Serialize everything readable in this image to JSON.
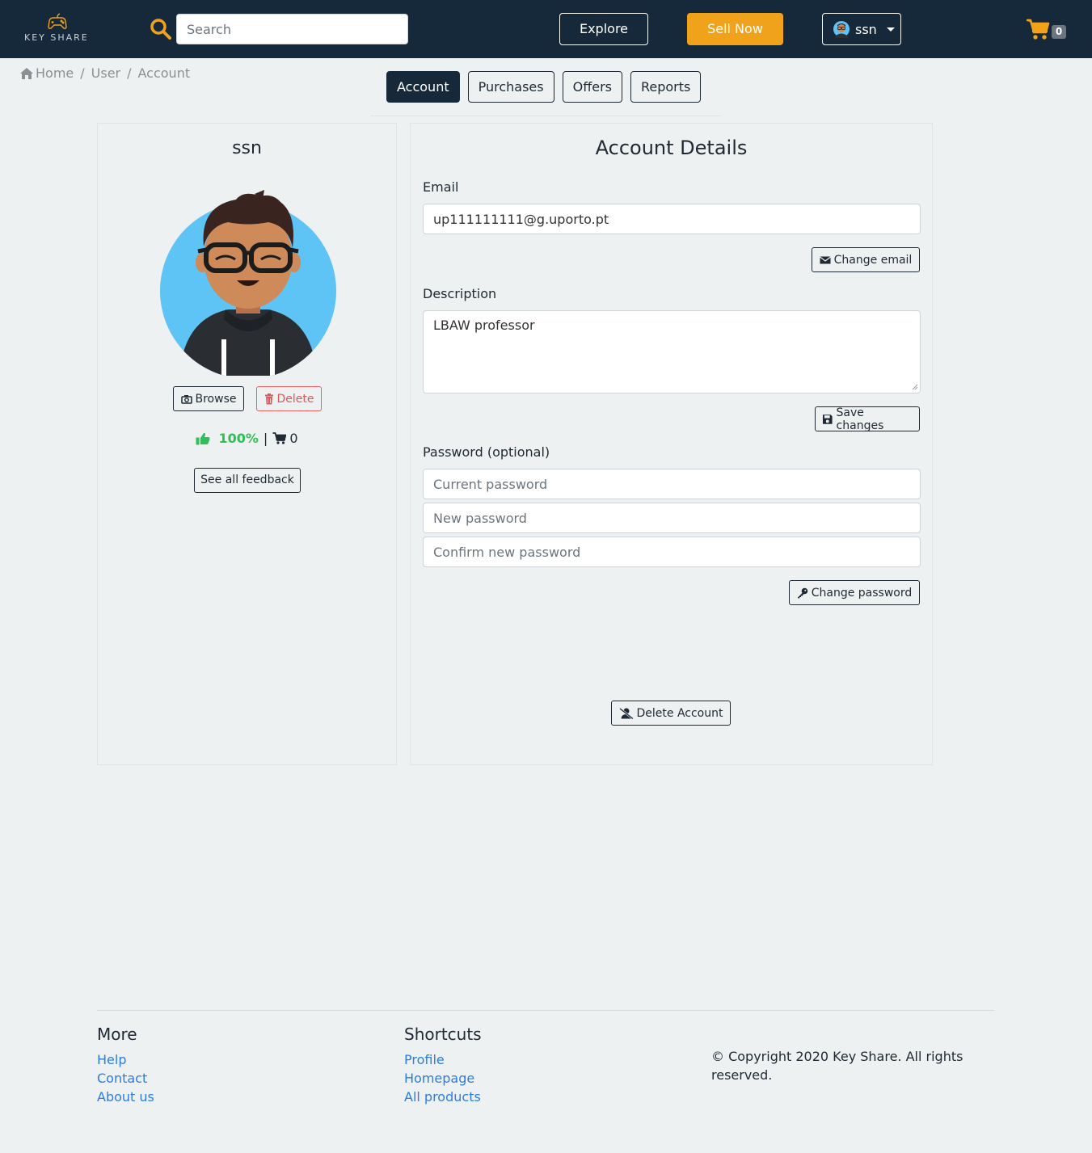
{
  "navbar": {
    "logo_text": "KEY SHARE",
    "search_placeholder": "Search",
    "explore_label": "Explore",
    "sell_label": "Sell Now",
    "user_label": "ssn",
    "cart_count": "0",
    "accent_color": "#f0a21b",
    "bg_color": "#16293a"
  },
  "breadcrumb": [
    "Home",
    "User",
    "Account"
  ],
  "tabs": [
    {
      "label": "Account",
      "active": true
    },
    {
      "label": "Purchases",
      "active": false
    },
    {
      "label": "Offers",
      "active": false
    },
    {
      "label": "Reports",
      "active": false
    }
  ],
  "profile": {
    "name": "ssn",
    "browse_label": "Browse",
    "delete_label": "Delete",
    "rating": "100%",
    "separator": "|",
    "purchases": "0",
    "feedback_label": "See all feedback"
  },
  "account": {
    "title": "Account Details",
    "email_label": "Email",
    "email_value": "up111111111@g.uporto.pt",
    "change_email_label": "Change email",
    "description_label": "Description",
    "description_value": "LBAW professor",
    "save_label": "Save changes",
    "password_label": "Password (optional)",
    "current_password_placeholder": "Current password",
    "new_password_placeholder": "New password",
    "confirm_password_placeholder": "Confirm new password",
    "change_password_label": "Change password",
    "delete_account_label": "Delete Account"
  },
  "footer": {
    "more_title": "More",
    "more_links": [
      "Help",
      "Contact",
      "About us"
    ],
    "shortcuts_title": "Shortcuts",
    "shortcut_links": [
      "Profile",
      "Homepage",
      "All products"
    ],
    "copyright": "© Copyright 2020 Key Share. All rights reserved."
  }
}
